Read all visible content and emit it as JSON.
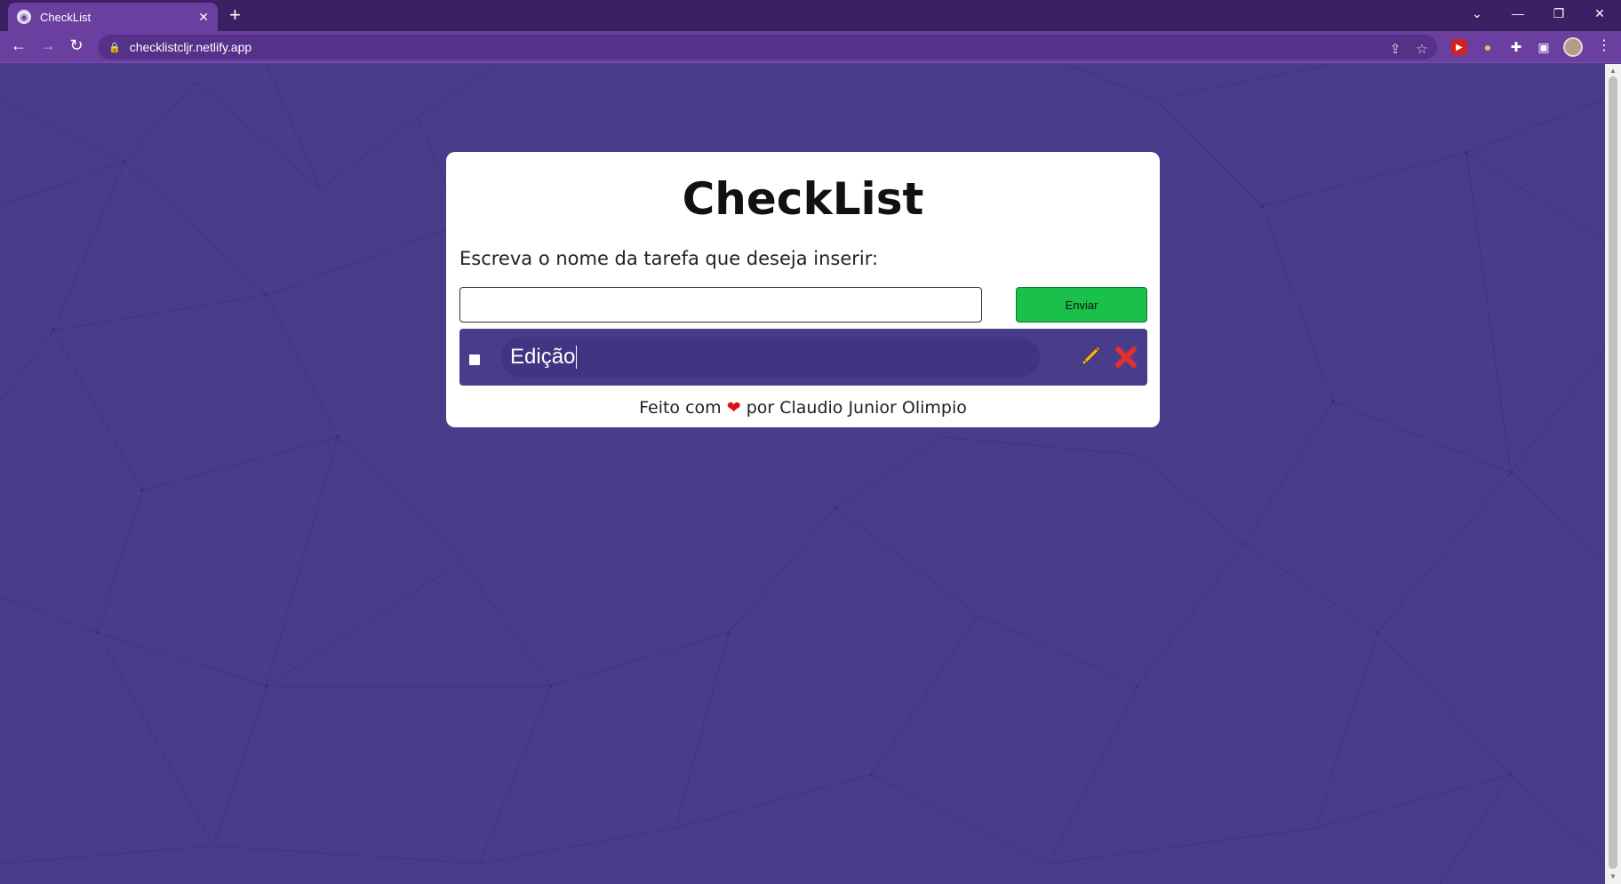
{
  "browser": {
    "tab_title": "CheckList",
    "favicon": "globe-icon",
    "tab_close": "✕",
    "new_tab": "+",
    "url": "checklistcljr.netlify.app",
    "extensions": [
      "youtube-ext-icon",
      "lamp-ext-icon",
      "puzzle-icon",
      "sidepanel-icon"
    ]
  },
  "page": {
    "title": "CheckList",
    "prompt": "Escreva o nome da tarefa que deseja inserir:",
    "input_value": "",
    "send_label": "Enviar",
    "tasks": [
      {
        "text": "Edição",
        "checked": false,
        "editing": true
      }
    ],
    "footer_prefix": "Feito com",
    "footer_heart": "❤",
    "footer_suffix": "por Claudio Junior Olimpio"
  },
  "colors": {
    "page_background": "#483d8b",
    "send_button": "#19c14a",
    "delete_icon": "#e03030"
  }
}
